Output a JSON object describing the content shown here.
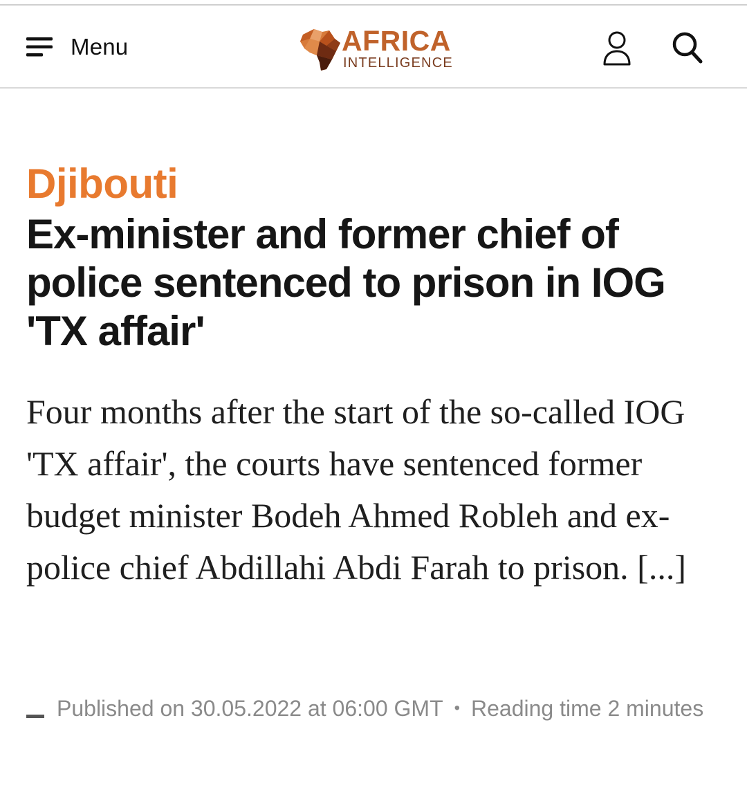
{
  "header": {
    "menu_label": "Menu",
    "logo": {
      "word": "AFRICA",
      "sub": "INTELLIGENCE"
    },
    "icons": {
      "menu": "hamburger-icon",
      "account": "user-icon",
      "search": "search-icon"
    }
  },
  "article": {
    "kicker": "Djibouti",
    "headline": "Ex-minister and former chief of police sentenced to prison in IOG 'TX affair'",
    "lede": "Four months after the start of the so-called IOG 'TX affair', the courts have sentenced former budget minister Bodeh Ahmed Robleh and ex-police chief Abdillahi Abdi Farah to prison. [...]",
    "published": "Published on 30.05.2022 at 06:00 GMT",
    "separator": "•",
    "reading_time": "Reading time 2 minutes"
  },
  "colors": {
    "kicker": "#e87a2f",
    "logo_word": "#c0622a",
    "logo_sub": "#7a3c1f",
    "meta_text": "#8a8a8a"
  }
}
